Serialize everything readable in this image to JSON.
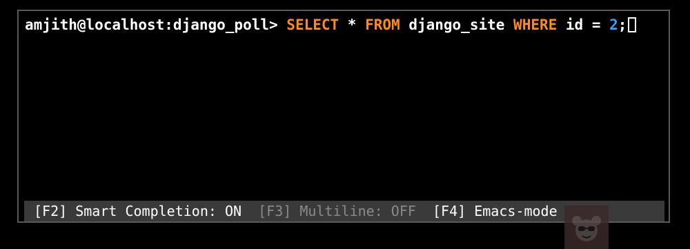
{
  "terminal": {
    "prompt": "amjith@localhost:django_poll> ",
    "query_tokens": {
      "kw_select": "SELECT",
      "star": " * ",
      "kw_from": "FROM",
      "table": " django_site ",
      "kw_where": "WHERE",
      "cond": " id = ",
      "value": "2",
      "terminator": ";"
    }
  },
  "toolbar": {
    "f2": "[F2] Smart Completion: ON",
    "f3": "[F3] Multiline: OFF",
    "f4": "[F4] Emacs-mode",
    "sep": "  "
  },
  "colors": {
    "keyword": "#ff8c1a",
    "number": "#3aa0ff",
    "background": "#000000",
    "toolbar_bg": "#3a3a3a",
    "dim_text": "#8a8a8a"
  }
}
